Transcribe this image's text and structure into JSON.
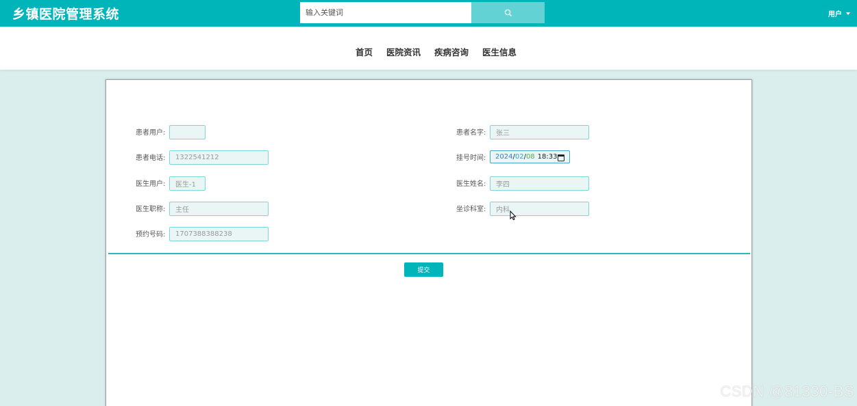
{
  "header": {
    "brand": "乡镇医院管理系统",
    "search_placeholder": "输入关键词",
    "user_menu": "用户"
  },
  "nav": {
    "items": [
      "首页",
      "医院资讯",
      "疾病咨询",
      "医生信息"
    ]
  },
  "form": {
    "patient_user": {
      "label": "患者用户:",
      "value": ""
    },
    "patient_name": {
      "label": "患者名字:",
      "value": "张三"
    },
    "patient_phone": {
      "label": "患者电话:",
      "value": "1322541212"
    },
    "register_time": {
      "label": "挂号时间:",
      "year": "2024",
      "month": "02",
      "day": "08",
      "time": "18:33"
    },
    "doctor_user": {
      "label": "医生用户:",
      "value": "医生-1"
    },
    "doctor_name": {
      "label": "医生姓名:",
      "value": "李四"
    },
    "doctor_title": {
      "label": "医生职称:",
      "value": "主任"
    },
    "department": {
      "label": "坐诊科室:",
      "value": "内科"
    },
    "appointment_no": {
      "label": "预约号码:",
      "value": "1707388388238"
    },
    "submit_label": "提交"
  },
  "watermark": "CSDN @81330-BS",
  "colors": {
    "accent": "#00b5b9",
    "search_button": "#62d2d5",
    "page_background": "#dbeeee",
    "field_border": "#7fd6d9"
  }
}
